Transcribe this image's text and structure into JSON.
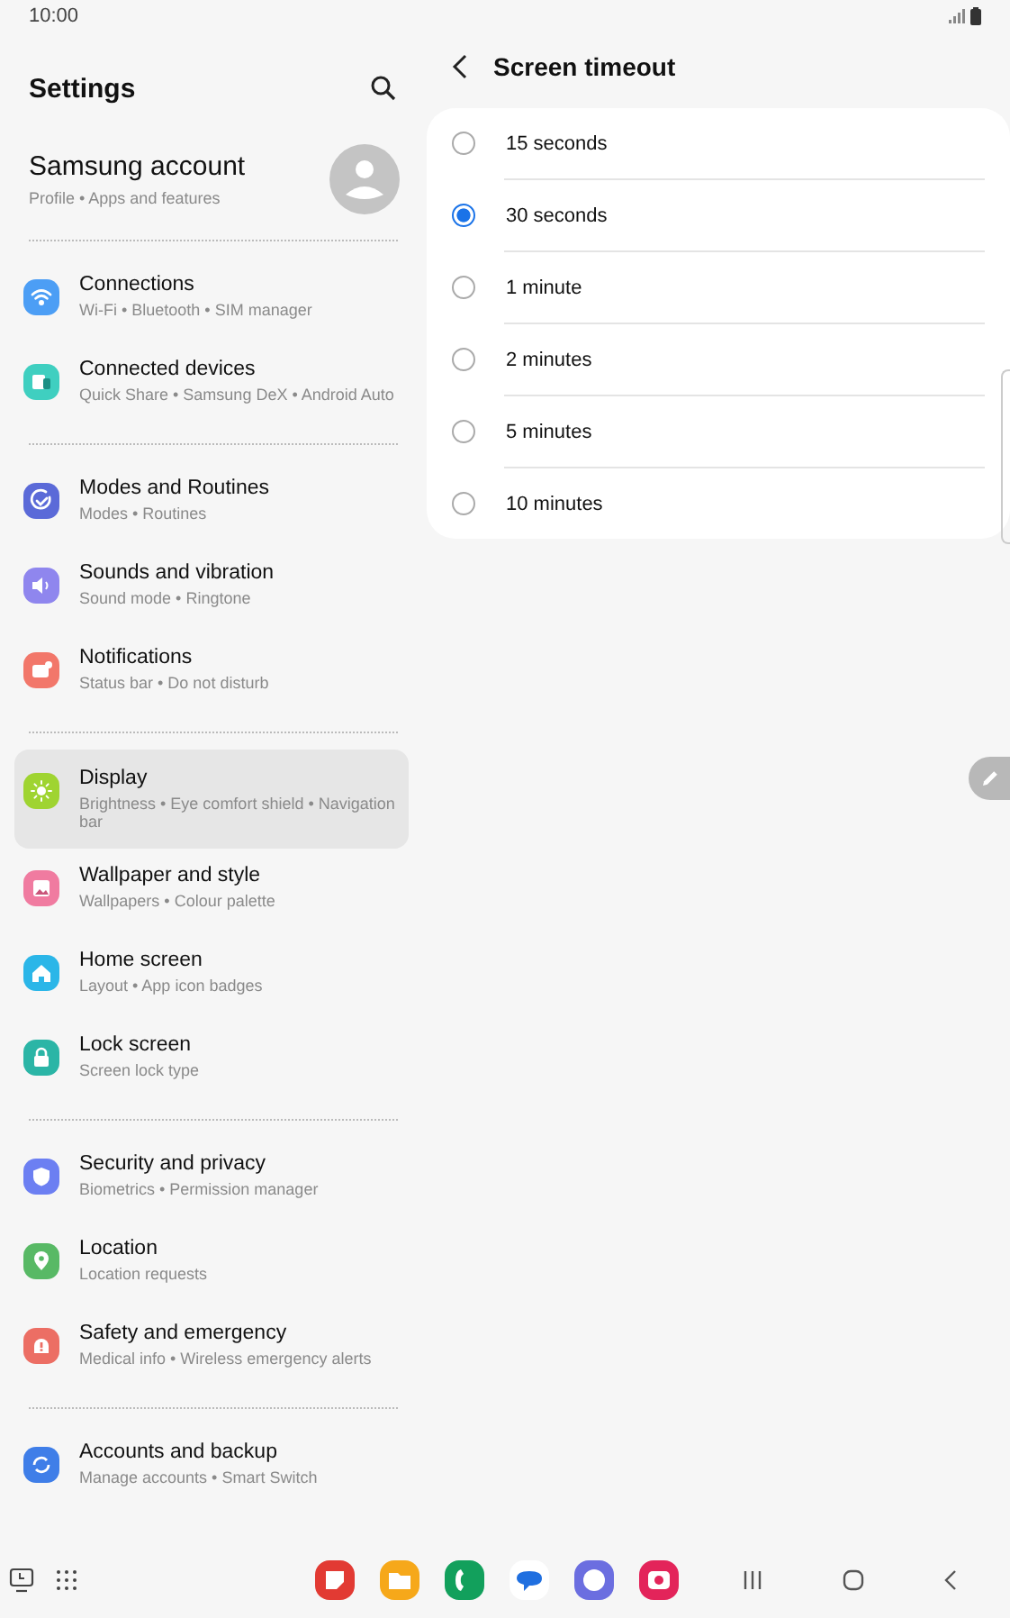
{
  "status_bar": {
    "time": "10:00"
  },
  "settings": {
    "title": "Settings",
    "account": {
      "name": "Samsung account",
      "subtitle": "Profile • Apps and features"
    },
    "groups": [
      {
        "items": [
          {
            "title": "Connections",
            "subtitle": "Wi-Fi • Bluetooth • SIM manager",
            "color": "#4c9ef5",
            "selected": false
          },
          {
            "title": "Connected devices",
            "subtitle": "Quick Share • Samsung DeX • Android Auto",
            "color": "#3fcfc0",
            "selected": false
          }
        ]
      },
      {
        "items": [
          {
            "title": "Modes and Routines",
            "subtitle": "Modes • Routines",
            "color": "#5b6ad8",
            "selected": false
          },
          {
            "title": "Sounds and vibration",
            "subtitle": "Sound mode • Ringtone",
            "color": "#8f86ee",
            "selected": false
          },
          {
            "title": "Notifications",
            "subtitle": "Status bar • Do not disturb",
            "color": "#f2776a",
            "selected": false
          }
        ]
      },
      {
        "items": [
          {
            "title": "Display",
            "subtitle": "Brightness • Eye comfort shield • Navigation bar",
            "color": "#9fd431",
            "selected": true
          },
          {
            "title": "Wallpaper and style",
            "subtitle": "Wallpapers • Colour palette",
            "color": "#f07ba0",
            "selected": false
          },
          {
            "title": "Home screen",
            "subtitle": "Layout • App icon badges",
            "color": "#2bb6e8",
            "selected": false
          },
          {
            "title": "Lock screen",
            "subtitle": "Screen lock type",
            "color": "#2bb5a6",
            "selected": false
          }
        ]
      },
      {
        "items": [
          {
            "title": "Security and privacy",
            "subtitle": "Biometrics • Permission manager",
            "color": "#6c7ff2",
            "selected": false
          },
          {
            "title": "Location",
            "subtitle": "Location requests",
            "color": "#58b965",
            "selected": false
          },
          {
            "title": "Safety and emergency",
            "subtitle": "Medical info • Wireless emergency alerts",
            "color": "#ec6e64",
            "selected": false
          }
        ]
      },
      {
        "items": [
          {
            "title": "Accounts and backup",
            "subtitle": "Manage accounts • Smart Switch",
            "color": "#3f7ee8",
            "selected": false
          }
        ]
      }
    ]
  },
  "screen_timeout": {
    "title": "Screen timeout",
    "options": [
      {
        "label": "15 seconds",
        "selected": false
      },
      {
        "label": "30 seconds",
        "selected": true
      },
      {
        "label": "1 minute",
        "selected": false
      },
      {
        "label": "2 minutes",
        "selected": false
      },
      {
        "label": "5 minutes",
        "selected": false
      },
      {
        "label": "10 minutes",
        "selected": false
      }
    ]
  }
}
